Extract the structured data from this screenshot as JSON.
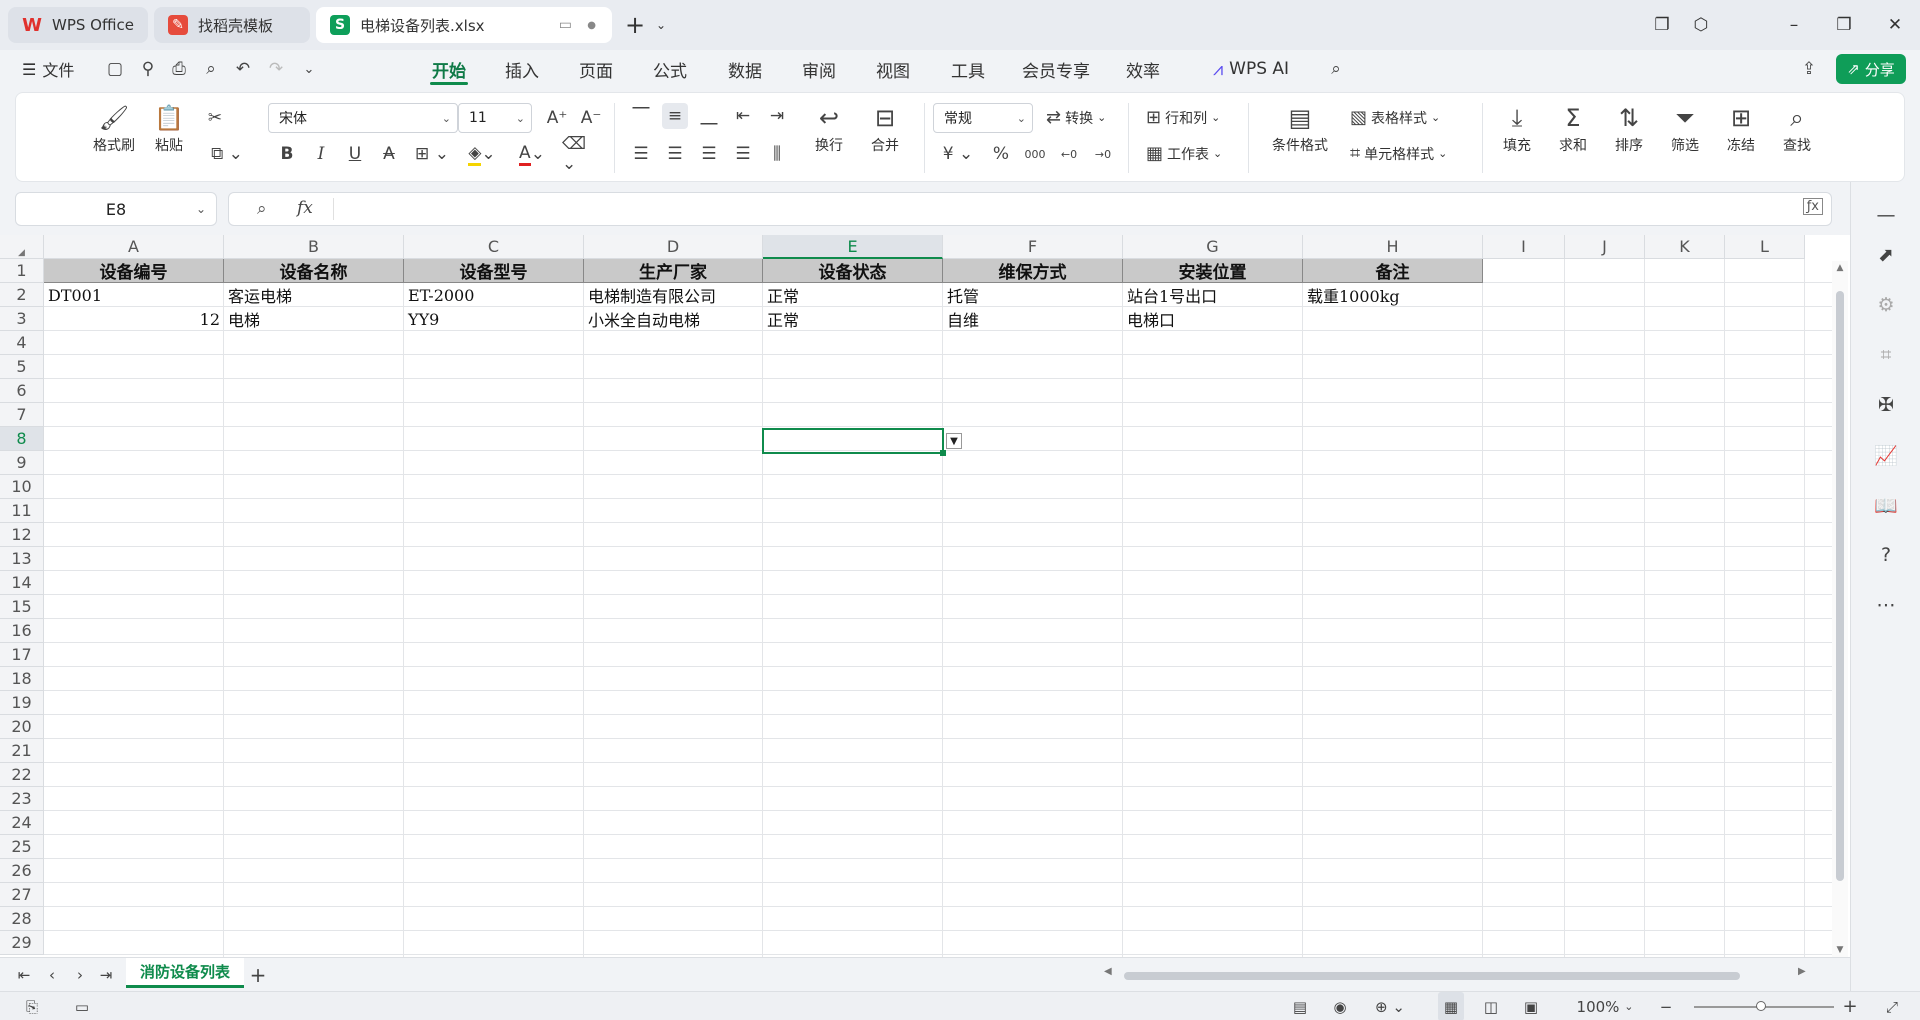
{
  "tabs": [
    {
      "label": "WPS Office",
      "logo": "W",
      "logo_color": "#e0312d",
      "icon": "wps-logo-icon"
    },
    {
      "label": "找稻壳模板",
      "logo": "✎",
      "logo_color": "#e64b3c",
      "icon": "docer-icon"
    },
    {
      "label": "电梯设备列表.xlsx",
      "logo": "S",
      "logo_color": "#0e9f5a",
      "icon": "spreadsheet-icon"
    }
  ],
  "menu": {
    "file_label": "文件",
    "items": [
      "开始",
      "插入",
      "页面",
      "公式",
      "数据",
      "审阅",
      "视图",
      "工具",
      "会员专享",
      "效率",
      "WPS AI"
    ],
    "active": "开始",
    "share_label": "分享"
  },
  "ribbon": {
    "format_painter": "格式刷",
    "paste": "粘贴",
    "font_name": "宋体",
    "font_size": "11",
    "bold": "B",
    "italic": "I",
    "underline": "U",
    "strike": "A",
    "wrap": "换行",
    "merge": "合并",
    "number_format": "常规",
    "convert": "转换",
    "rows_cols": "行和列",
    "worksheet": "工作表",
    "cond_format": "条件格式",
    "table_style": "表格样式",
    "cell_style": "单元格样式",
    "fill": "填充",
    "sum": "求和",
    "sort": "排序",
    "filter": "筛选",
    "freeze": "冻结",
    "find": "查找",
    "currency": "¥",
    "percent": "%"
  },
  "formula": {
    "name_box": "E8",
    "fx": "fx",
    "content": ""
  },
  "grid": {
    "columns": [
      "A",
      "B",
      "C",
      "D",
      "E",
      "F",
      "G",
      "H",
      "I",
      "J",
      "K",
      "L"
    ],
    "selected_column": "E",
    "selected_row": 8,
    "row_numbers": [
      "1",
      "2",
      "3",
      "4",
      "5",
      "6",
      "7",
      "8",
      "9",
      "10",
      "11",
      "12",
      "13",
      "14",
      "15",
      "16",
      "17",
      "18",
      "19",
      "20",
      "21",
      "22",
      "23",
      "24",
      "25",
      "26",
      "27",
      "28",
      "29"
    ],
    "headers": [
      "设备编号",
      "设备名称",
      "设备型号",
      "生产厂家",
      "设备状态",
      "维保方式",
      "安装位置",
      "备注"
    ],
    "rows": [
      [
        "DT001",
        "客运电梯",
        "ET-2000",
        "电梯制造有限公司",
        "正常",
        "托管",
        "站台1号出口",
        "载重1000kg"
      ],
      [
        "12",
        "电梯",
        "YY9",
        "小米全自动电梯",
        "正常",
        "自维",
        "电梯口",
        ""
      ]
    ]
  },
  "sheet_tabs": [
    {
      "label": "消防设备列表",
      "active": true
    }
  ],
  "status": {
    "zoom": "100%"
  },
  "colors": {
    "accent": "#0f8b4c",
    "header_fill": "#c9c9c9",
    "share_button": "#0f9d58"
  }
}
